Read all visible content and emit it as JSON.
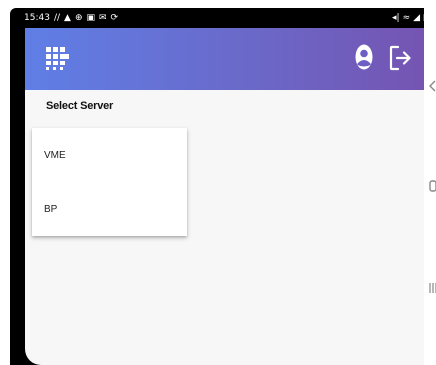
{
  "status_bar": {
    "time": "15:43",
    "left_icons": [
      "phone-icon",
      "alert-icon",
      "location-icon",
      "image-icon",
      "mail-icon",
      "sync-icon"
    ],
    "right_icons": [
      "mute-icon",
      "wifi-icon",
      "signal-icon",
      "battery-icon"
    ]
  },
  "app_bar": {
    "gradient_start": "#5f7fe6",
    "gradient_end": "#7554b2",
    "icons": [
      "app-logo-icon",
      "user-icon",
      "logout-icon"
    ]
  },
  "section": {
    "title": "Select Server"
  },
  "servers": [
    {
      "label": "VME"
    },
    {
      "label": "BP"
    }
  ]
}
